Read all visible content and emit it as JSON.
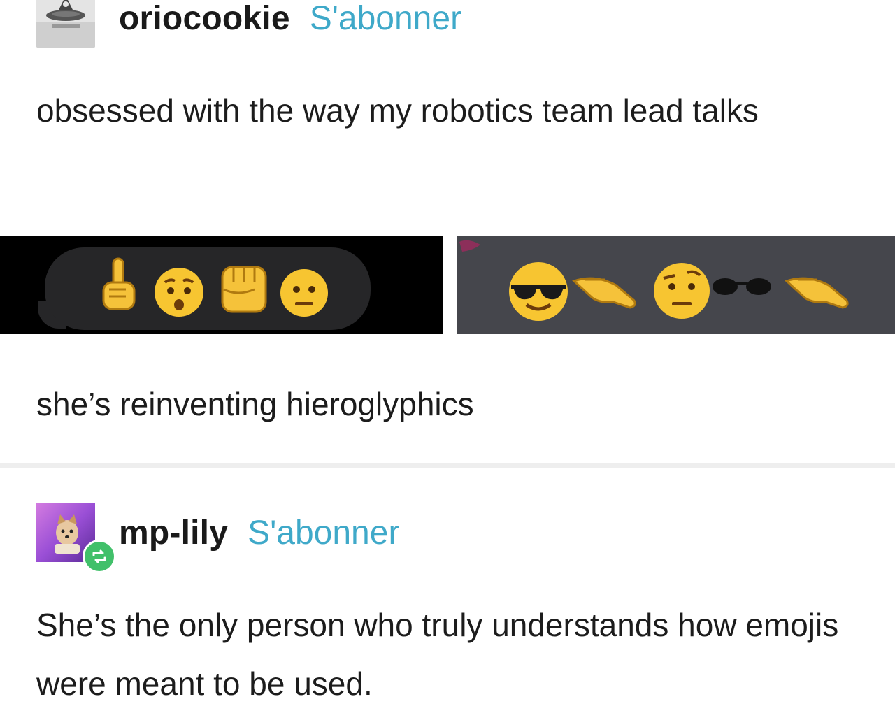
{
  "post1": {
    "username": "oriocookie",
    "follow_label": "S'abonner",
    "text_1": "obsessed with the way my robotics team lead talks",
    "text_2": "she’s reinventing hieroglyphics",
    "image_left": {
      "emojis": [
        "index-pointing-up-emoji",
        "anxious-face-emoji",
        "raised-fist-emoji",
        "neutral-face-emoji"
      ]
    },
    "image_right": {
      "emojis": [
        "sunglasses-face-emoji",
        "pinching-hand-emoji",
        "raised-eyebrow-face-emoji",
        "sunglasses-emoji",
        "pinching-hand-emoji"
      ]
    }
  },
  "post2": {
    "username": "mp-lily",
    "follow_label": "S'abonner",
    "text": "She’s the only person who truly understands how emojis were meant to be used."
  },
  "colors": {
    "follow": "#3fa9c9",
    "reblog_badge": "#41c06a",
    "left_panel": "#000000",
    "right_panel": "#45464c"
  }
}
